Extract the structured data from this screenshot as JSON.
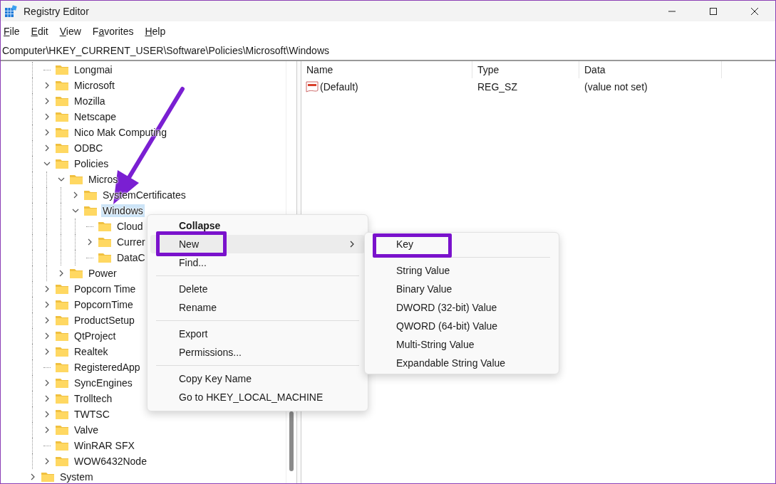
{
  "window": {
    "title": "Registry Editor"
  },
  "menu_bar": [
    {
      "mnemonic": "F",
      "after": "ile"
    },
    {
      "mnemonic": "E",
      "after": "dit"
    },
    {
      "mnemonic": "V",
      "after": "iew"
    },
    {
      "before": "F",
      "mnemonic": "a",
      "after": "vorites"
    },
    {
      "mnemonic": "H",
      "after": "elp"
    }
  ],
  "address_bar": {
    "value": "Computer\\HKEY_CURRENT_USER\\Software\\Policies\\Microsoft\\Windows"
  },
  "tree": {
    "items": [
      {
        "children": [
          {
            "label": "Longmai",
            "has_children": false,
            "selected": false
          },
          {
            "label": "Microsoft",
            "has_children": true,
            "expanded": false,
            "selected": false
          },
          {
            "label": "Mozilla",
            "has_children": true,
            "expanded": false,
            "selected": false
          },
          {
            "label": "Netscape",
            "has_children": true,
            "expanded": false,
            "selected": false
          },
          {
            "label": "Nico Mak Computing",
            "has_children": true,
            "expanded": false,
            "selected": false
          },
          {
            "label": "ODBC",
            "has_children": true,
            "expanded": false,
            "selected": false
          },
          {
            "label": "Policies",
            "has_children": true,
            "expanded": true,
            "selected": false,
            "children": [
              {
                "label": "Micros",
                "has_children": true,
                "expanded": true,
                "selected": false,
                "children": [
                  {
                    "label": "SystemCertificates",
                    "has_children": true,
                    "expanded": false,
                    "selected": false
                  },
                  {
                    "label": "Windows",
                    "has_children": true,
                    "expanded": true,
                    "selected": true,
                    "children": [
                      {
                        "label": "Cloud",
                        "has_children": false,
                        "selected": false
                      },
                      {
                        "label": "Currer",
                        "has_children": true,
                        "expanded": false,
                        "selected": false
                      },
                      {
                        "label": "DataC",
                        "has_children": false,
                        "selected": false
                      }
                    ]
                  }
                ]
              },
              {
                "label": "Power",
                "has_children": true,
                "expanded": false,
                "selected": false
              }
            ]
          },
          {
            "label": "Popcorn Time",
            "has_children": true,
            "expanded": false,
            "selected": false
          },
          {
            "label": "PopcornTime",
            "has_children": true,
            "expanded": false,
            "selected": false
          },
          {
            "label": "ProductSetup",
            "has_children": true,
            "expanded": false,
            "selected": false
          },
          {
            "label": "QtProject",
            "has_children": true,
            "expanded": false,
            "selected": false
          },
          {
            "label": "Realtek",
            "has_children": true,
            "expanded": false,
            "selected": false
          },
          {
            "label": "RegisteredApp",
            "has_children": false,
            "selected": false
          },
          {
            "label": "SyncEngines",
            "has_children": true,
            "expanded": false,
            "selected": false
          },
          {
            "label": "Trolltech",
            "has_children": true,
            "expanded": false,
            "selected": false
          },
          {
            "label": "TWTSC",
            "has_children": true,
            "expanded": false,
            "selected": false
          },
          {
            "label": "Valve",
            "has_children": true,
            "expanded": false,
            "selected": false
          },
          {
            "label": "WinRAR SFX",
            "has_children": false,
            "selected": false
          },
          {
            "label": "WOW6432Node",
            "has_children": true,
            "expanded": false,
            "selected": false
          }
        ]
      },
      {
        "label": "System",
        "has_children": true,
        "expanded": false,
        "selected": false
      }
    ]
  },
  "values_table": {
    "columns": [
      "Name",
      "Type",
      "Data"
    ],
    "rows": [
      {
        "name": "(Default)",
        "type": "REG_SZ",
        "data": "(value not set)"
      }
    ]
  },
  "context_menu": {
    "groups": [
      [
        {
          "label": "Collapse",
          "bold": true,
          "selected": false,
          "highlighted": false,
          "submenu": false
        },
        {
          "label": "New",
          "bold": false,
          "selected": true,
          "highlighted": true,
          "submenu": true
        },
        {
          "label": "Find...",
          "bold": false,
          "selected": false,
          "highlighted": false,
          "submenu": false
        }
      ],
      [
        {
          "label": "Delete",
          "bold": false,
          "selected": false,
          "highlighted": false,
          "submenu": false
        },
        {
          "label": "Rename",
          "bold": false,
          "selected": false,
          "highlighted": false,
          "submenu": false
        }
      ],
      [
        {
          "label": "Export",
          "bold": false,
          "selected": false,
          "highlighted": false,
          "submenu": false
        },
        {
          "label": "Permissions...",
          "bold": false,
          "selected": false,
          "highlighted": false,
          "submenu": false
        }
      ],
      [
        {
          "label": "Copy Key Name",
          "bold": false,
          "selected": false,
          "highlighted": false,
          "submenu": false
        },
        {
          "label": "Go to HKEY_LOCAL_MACHINE",
          "bold": false,
          "selected": false,
          "highlighted": false,
          "submenu": false
        }
      ]
    ]
  },
  "submenu": {
    "groups": [
      [
        {
          "label": "Key",
          "highlighted": true
        }
      ],
      [
        {
          "label": "String Value",
          "highlighted": false
        },
        {
          "label": "Binary Value",
          "highlighted": false
        },
        {
          "label": "DWORD (32-bit) Value",
          "highlighted": false
        },
        {
          "label": "QWORD (64-bit) Value",
          "highlighted": false
        },
        {
          "label": "Multi-String Value",
          "highlighted": false
        },
        {
          "label": "Expandable String Value",
          "highlighted": false
        }
      ]
    ]
  }
}
